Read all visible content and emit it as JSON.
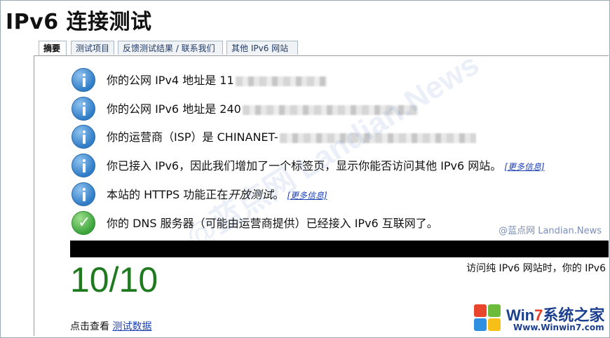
{
  "page": {
    "title": "IPv6 连接测试"
  },
  "tabs": [
    {
      "label": "摘要",
      "active": true
    },
    {
      "label": "测试项目",
      "active": false
    },
    {
      "label": "反馈测试结果 / 联系我们",
      "active": false
    },
    {
      "label": "其他 IPv6 网站",
      "active": false
    }
  ],
  "rows": [
    {
      "icon": "info-icon",
      "prefix": "你的公网 IPv4 地址是 ",
      "visible_value": "11"
    },
    {
      "icon": "info-icon",
      "prefix": "你的公网 IPv6 地址是 ",
      "visible_value": "240"
    },
    {
      "icon": "info-icon",
      "prefix": "你的运营商（ISP）是 ",
      "visible_value": "CHINANET-"
    },
    {
      "icon": "info-icon",
      "text": "你已接入 IPv6，因此我们增加了一个标签页，显示你能否访问其他 IPv6 网站。",
      "link": "[更多信息]"
    },
    {
      "icon": "info-icon",
      "text_before": "本站的 HTTPS 功能正在",
      "text_em": "开放测试",
      "text_after": "。",
      "link": "[更多信息]"
    },
    {
      "icon": "check-icon",
      "text": "你的 DNS 服务器（可能由运营商提供）已经接入 IPv6 互联网了。"
    }
  ],
  "score": {
    "value": "10/10",
    "note": "访问纯 IPv6 网站时，你的 IPv6"
  },
  "footer": {
    "prefix": "点击查看 ",
    "link": "测试数据"
  },
  "watermarks": {
    "corner": "@蓝点网 Landian.News",
    "diagonal": "@蓝点网 Landian.News",
    "logo_name_win": "Win",
    "logo_name_seven": "7",
    "logo_name_rest": "系统之家",
    "logo_url": "Www.Winwin7.com"
  },
  "colors": {
    "score_green": "#1f7a1f",
    "link_blue": "#1a3fb3",
    "info_blue": "#2f7cc7",
    "ok_green": "#3aa33a"
  }
}
